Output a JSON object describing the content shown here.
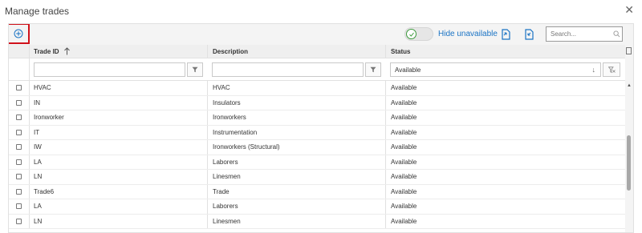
{
  "dialog": {
    "title": "Manage trades",
    "close_glyph": "✕"
  },
  "toolbar": {
    "add_icon": "plus-circle-icon",
    "toggle_on": true,
    "hide_unavailable_label": "Hide unavailable",
    "export_icon": "export-icon",
    "import_icon": "import-icon",
    "search_placeholder": "Search..."
  },
  "columns": [
    {
      "key": "trade_id",
      "label": "Trade ID",
      "sort": "asc"
    },
    {
      "key": "description",
      "label": "Description"
    },
    {
      "key": "status",
      "label": "Status"
    }
  ],
  "filters": {
    "status_value": "Available"
  },
  "rows": [
    {
      "trade_id": "HVAC",
      "description": "HVAC",
      "status": "Available"
    },
    {
      "trade_id": "IN",
      "description": "Insulators",
      "status": "Available"
    },
    {
      "trade_id": "Ironworker",
      "description": "Ironworkers",
      "status": "Available"
    },
    {
      "trade_id": "IT",
      "description": "Instrumentation",
      "status": "Available"
    },
    {
      "trade_id": "IW",
      "description": "Ironworkers (Structural)",
      "status": "Available"
    },
    {
      "trade_id": "LA",
      "description": "Laborers",
      "status": "Available"
    },
    {
      "trade_id": "LN",
      "description": "Linesmen",
      "status": "Available"
    },
    {
      "trade_id": "Trade6",
      "description": "Trade",
      "status": "Available"
    },
    {
      "trade_id": "LA",
      "description": "Laborers",
      "status": "Available"
    },
    {
      "trade_id": "LN",
      "description": "Linesmen",
      "status": "Available"
    }
  ],
  "colors": {
    "accent": "#1a73c4",
    "highlight": "#d0121b",
    "toggle_check": "#3d9a3d"
  }
}
